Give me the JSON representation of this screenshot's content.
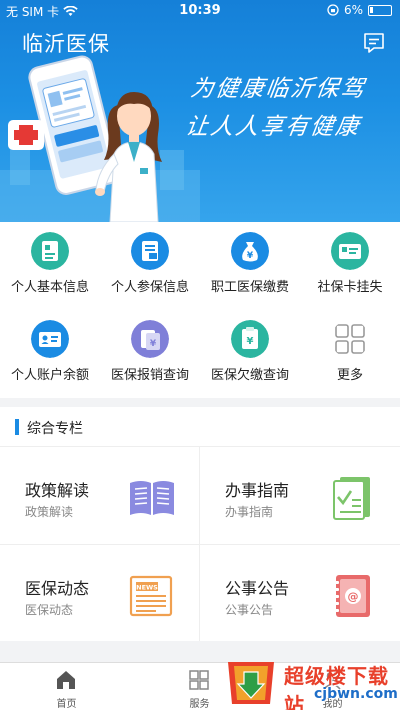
{
  "status_bar": {
    "carrier": "无 SIM 卡",
    "time": "10:39",
    "battery": "6%"
  },
  "header": {
    "title": "临沂医保",
    "slogan_line1": "为健康临沂保驾",
    "slogan_line2": "让人人享有健康",
    "message_icon": "message-icon"
  },
  "services": [
    {
      "label": "个人基本信息",
      "icon": "id-card-icon",
      "color": "#2bb5a0"
    },
    {
      "label": "个人参保信息",
      "icon": "insurance-doc-icon",
      "color": "#1a8be3"
    },
    {
      "label": "职工医保缴费",
      "icon": "money-bag-icon",
      "color": "#1a8be3"
    },
    {
      "label": "社保卡挂失",
      "icon": "card-lock-icon",
      "color": "#2bb5a0"
    },
    {
      "label": "个人账户余额",
      "icon": "account-card-icon",
      "color": "#1a8be3"
    },
    {
      "label": "医保报销查询",
      "icon": "reimburse-icon",
      "color": "#7f7fd8"
    },
    {
      "label": "医保欠缴查询",
      "icon": "arrears-icon",
      "color": "#2bb5a0"
    },
    {
      "label": "更多",
      "icon": "more-grid-icon",
      "color": "#999999"
    }
  ],
  "section": {
    "title": "综合专栏"
  },
  "cards": [
    {
      "title": "政策解读",
      "subtitle": "政策解读",
      "icon": "open-book-icon",
      "color": "#8a8ae0"
    },
    {
      "title": "办事指南",
      "subtitle": "办事指南",
      "icon": "checklist-icon",
      "color": "#7cc46a"
    },
    {
      "title": "医保动态",
      "subtitle": "医保动态",
      "icon": "news-icon",
      "color": "#f0a050"
    },
    {
      "title": "公事公告",
      "subtitle": "公事公告",
      "icon": "notice-book-icon",
      "color": "#e86a6a"
    }
  ],
  "tabbar": [
    {
      "label": "首页",
      "icon": "home-icon"
    },
    {
      "label": "服务",
      "icon": "service-icon"
    },
    {
      "label": "我的",
      "icon": "profile-icon"
    }
  ],
  "watermark": {
    "text": "超级楼下载站",
    "url": "cjbwn.com"
  },
  "colors": {
    "primary": "#1a8be3",
    "teal": "#2bb5a0"
  }
}
